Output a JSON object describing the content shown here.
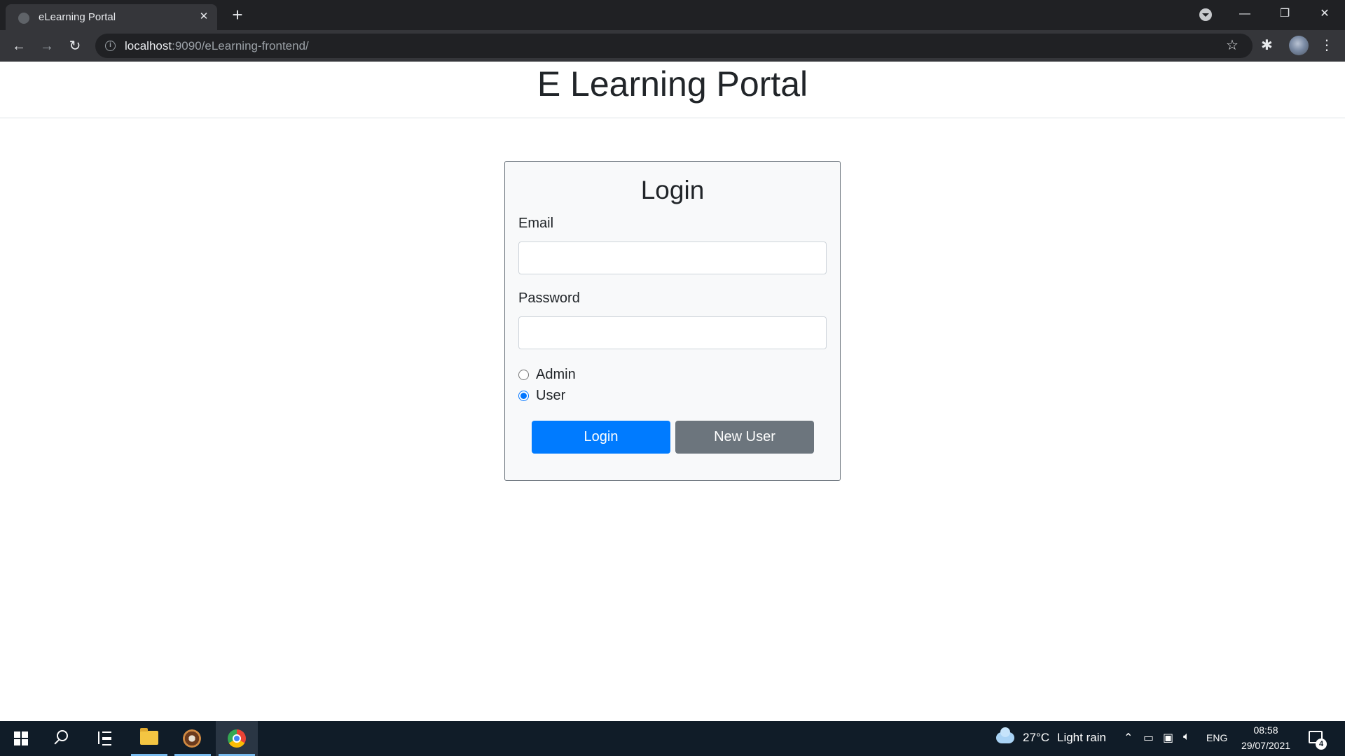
{
  "browser": {
    "tab_title": "eLearning Portal",
    "tab_close": "✕",
    "new_tab": "+",
    "url_host": "localhost",
    "url_rest": ":9090/eLearning-frontend/",
    "window_min": "—",
    "window_restore": "❐",
    "window_close": "✕"
  },
  "page": {
    "site_title": "E Learning Portal",
    "login_title": "Login",
    "email_label": "Email",
    "email_value": "",
    "password_label": "Password",
    "password_value": "",
    "roles": [
      {
        "label": "Admin",
        "checked": false
      },
      {
        "label": "User",
        "checked": true
      }
    ],
    "login_button": "Login",
    "new_user_button": "New User"
  },
  "taskbar": {
    "temperature": "27°C",
    "weather": "Light rain",
    "language": "ENG",
    "time": "08:58",
    "date": "29/07/2021",
    "notification_count": "4"
  },
  "colors": {
    "primary": "#007bff",
    "secondary": "#6c757d",
    "radio_accent": "#0075ff"
  }
}
